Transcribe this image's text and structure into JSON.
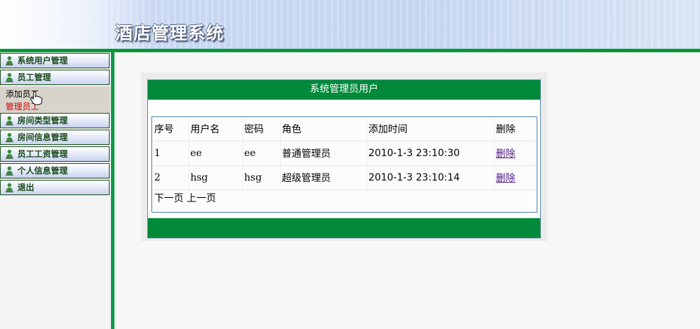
{
  "header": {
    "title": "酒店管理系统"
  },
  "sidebar": {
    "items": [
      {
        "label": "系统用户管理"
      },
      {
        "label": "员工管理"
      },
      {
        "label": "房间类型管理"
      },
      {
        "label": "房间信息管理"
      },
      {
        "label": "员工工资管理"
      },
      {
        "label": "个人信息管理"
      },
      {
        "label": "退出"
      }
    ],
    "submenu": [
      {
        "label": "添加员工"
      },
      {
        "label": "管理员工"
      }
    ]
  },
  "panel": {
    "title": "系统管理员用户",
    "columns": [
      "序号",
      "用户名",
      "密码",
      "角色",
      "添加时间",
      "删除"
    ],
    "rows": [
      {
        "id": "1",
        "username": "ee",
        "password": "ee",
        "role": "普通管理员",
        "added": "2010-1-3 23:10:30",
        "action": "删除"
      },
      {
        "id": "2",
        "username": "hsg",
        "password": "hsg",
        "role": "超级管理员",
        "added": "2010-1-3 23:10:14",
        "action": "删除"
      }
    ],
    "pager": {
      "next": "下一页",
      "prev": "上一页"
    }
  },
  "colors": {
    "green": "#008a3a",
    "header_blue": "#c5d5f0",
    "link": "#551a8b",
    "submenu_active": "#cc0000"
  },
  "icons": [
    "user-icon",
    "mouse-pointer-icon"
  ]
}
